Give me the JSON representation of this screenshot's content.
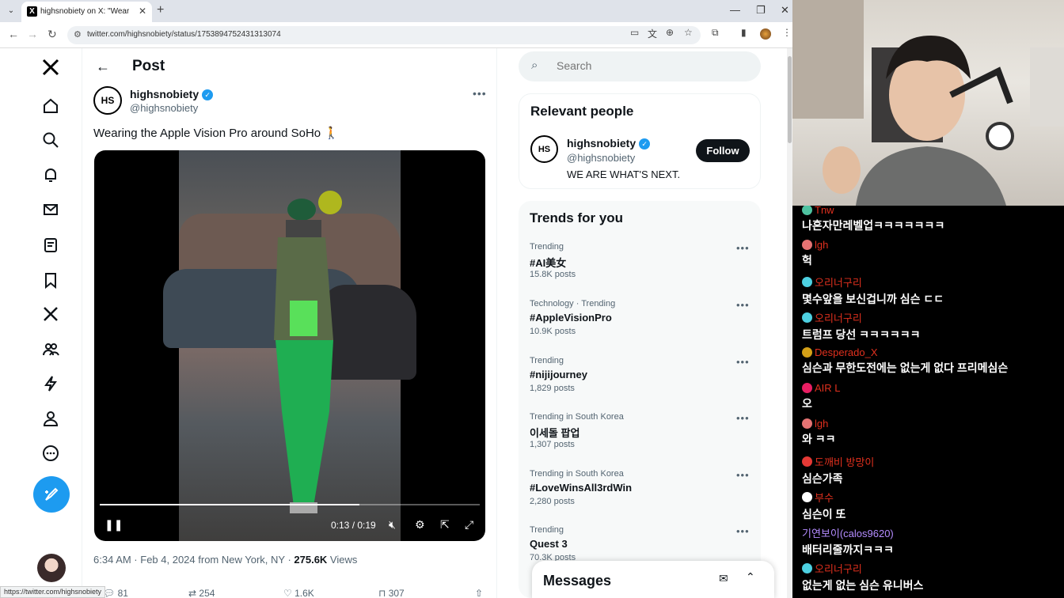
{
  "browser": {
    "tab_title": "highsnobiety on X: \"Wearing t",
    "tab_favicon": "X",
    "url": "twitter.com/highsnobiety/status/1753894752431313074",
    "status_url": "https://twitter.com/highsnobiety"
  },
  "post": {
    "header": "Post",
    "author_initials": "HS",
    "author_name": "highsnobiety",
    "author_handle": "@highsnobiety",
    "text": "Wearing the Apple Vision Pro around SoHo 🚶",
    "video_time": "0:13 / 0:19",
    "video_progress": 0.684,
    "meta_time": "6:34 AM · Feb 4, 2024 from New York, NY · ",
    "views": "275.6K",
    "views_label": " Views",
    "replies": "81",
    "reposts": "254",
    "likes": "1.6K",
    "bookmarks": "307"
  },
  "search": {
    "placeholder": "Search"
  },
  "relevant": {
    "title": "Relevant people",
    "name": "highsnobiety",
    "handle": "@highsnobiety",
    "bio": "WE ARE WHAT'S NEXT.",
    "follow": "Follow"
  },
  "trends": {
    "title": "Trends for you",
    "items": [
      {
        "context": "Trending",
        "name": "#AI美女",
        "count": "15.8K posts"
      },
      {
        "context": "Technology · Trending",
        "name": "#AppleVisionPro",
        "count": "10.9K posts"
      },
      {
        "context": "Trending",
        "name": "#nijijourney",
        "count": "1,829 posts"
      },
      {
        "context": "Trending in South Korea",
        "name": "이세돌 팝업",
        "count": "1,307 posts"
      },
      {
        "context": "Trending in South Korea",
        "name": "#LoveWinsAll3rdWin",
        "count": "2,280 posts"
      },
      {
        "context": "Trending",
        "name": "Quest 3",
        "count": "70.3K posts"
      }
    ]
  },
  "messages": {
    "title": "Messages"
  },
  "chat": [
    {
      "user": "Tnw",
      "text": "나혼자만레벨업ㅋㅋㅋㅋㅋㅋㅋ",
      "color": "#4fc3a1"
    },
    {
      "user": "lgh",
      "text": "헉",
      "color": "#e57373"
    },
    {
      "user": "오리너구리",
      "text": "몇수앞을 보신겁니까 심슨 ㄷㄷ",
      "color": "#4dd0e1"
    },
    {
      "user": "오리너구리",
      "text": "트럼프 당선 ㅋㅋㅋㅋㅋㅋ",
      "color": "#4dd0e1"
    },
    {
      "user": "Desperado_X",
      "text": "심슨과 무한도전에는 없는게 없다 프리메심슨",
      "color": "#d4a017"
    },
    {
      "user": "AIR L",
      "text": "오",
      "color": "#e91e63"
    },
    {
      "user": "lgh",
      "text": "와 ㅋㅋ",
      "color": "#e57373"
    },
    {
      "user": "도깨비 방망이",
      "text": "심슨가족",
      "color": "#e53935"
    },
    {
      "user": "부수",
      "text": "심슨이 또",
      "color": "#ffffff"
    },
    {
      "user": "기연보이(calos9620)",
      "text": "배터리줄까지ㅋㅋㅋ",
      "color": ""
    },
    {
      "user": "오리너구리",
      "text": "없는게 없는 심슨 유니버스",
      "color": "#4dd0e1"
    }
  ]
}
